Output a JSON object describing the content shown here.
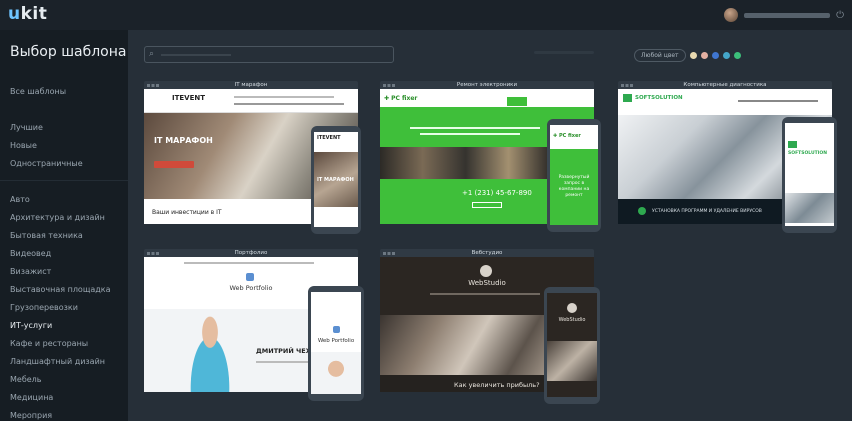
{
  "app": {
    "logo_u": "u",
    "logo_rest": "kit"
  },
  "sidebar": {
    "title": "Выбор шаблона",
    "groups": [
      {
        "label": "Все шаблоны"
      },
      {
        "label": "Лучшие"
      },
      {
        "label": "Новые"
      },
      {
        "label": "Одностраничные"
      }
    ],
    "categories": [
      "Авто",
      "Архитектура и дизайн",
      "Бытовая техника",
      "Видеовед",
      "Визажист",
      "Выставочная площадка",
      "Грузоперевозки",
      "ИТ-услуги",
      "Кафе и рестораны",
      "Ландшафтный дизайн",
      "Мебель",
      "Медицина",
      "Мероприя"
    ],
    "active_category": "ИТ-услуги"
  },
  "filters": {
    "color_filter_label": "Любой цвет",
    "swatches": [
      "#e8d9b0",
      "#e3b0a2",
      "#3f76d0",
      "#44a6c9",
      "#3cbf7a"
    ]
  },
  "templates": [
    {
      "title": "IT марафон",
      "brand": "ITEVENT",
      "hero": "IT МАРАФОН",
      "subtitle": "Ваши инвестиции в IT",
      "mobile_hero": "IT МАРАФОН"
    },
    {
      "title": "Ремонт электроники",
      "brand": "PC fixer",
      "phone_number": "+1 (231) 45-67-890",
      "mobile_text": "Развернутый запрос в компании на ремонт"
    },
    {
      "title": "Компьютерные диагностика",
      "brand": "SOFTSOLUTION",
      "banner": "УСТАНОВКА ПРОГРАММ И УДАЛЕНИЕ ВИРУСОВ"
    },
    {
      "title": "Портфолио",
      "brand": "Web Portfolio",
      "name": "ДМИТРИЙ ЧЕХОВ"
    },
    {
      "title": "Вебстудио",
      "brand": "WebStudio",
      "tagline": "Как увеличить прибыль?"
    }
  ]
}
